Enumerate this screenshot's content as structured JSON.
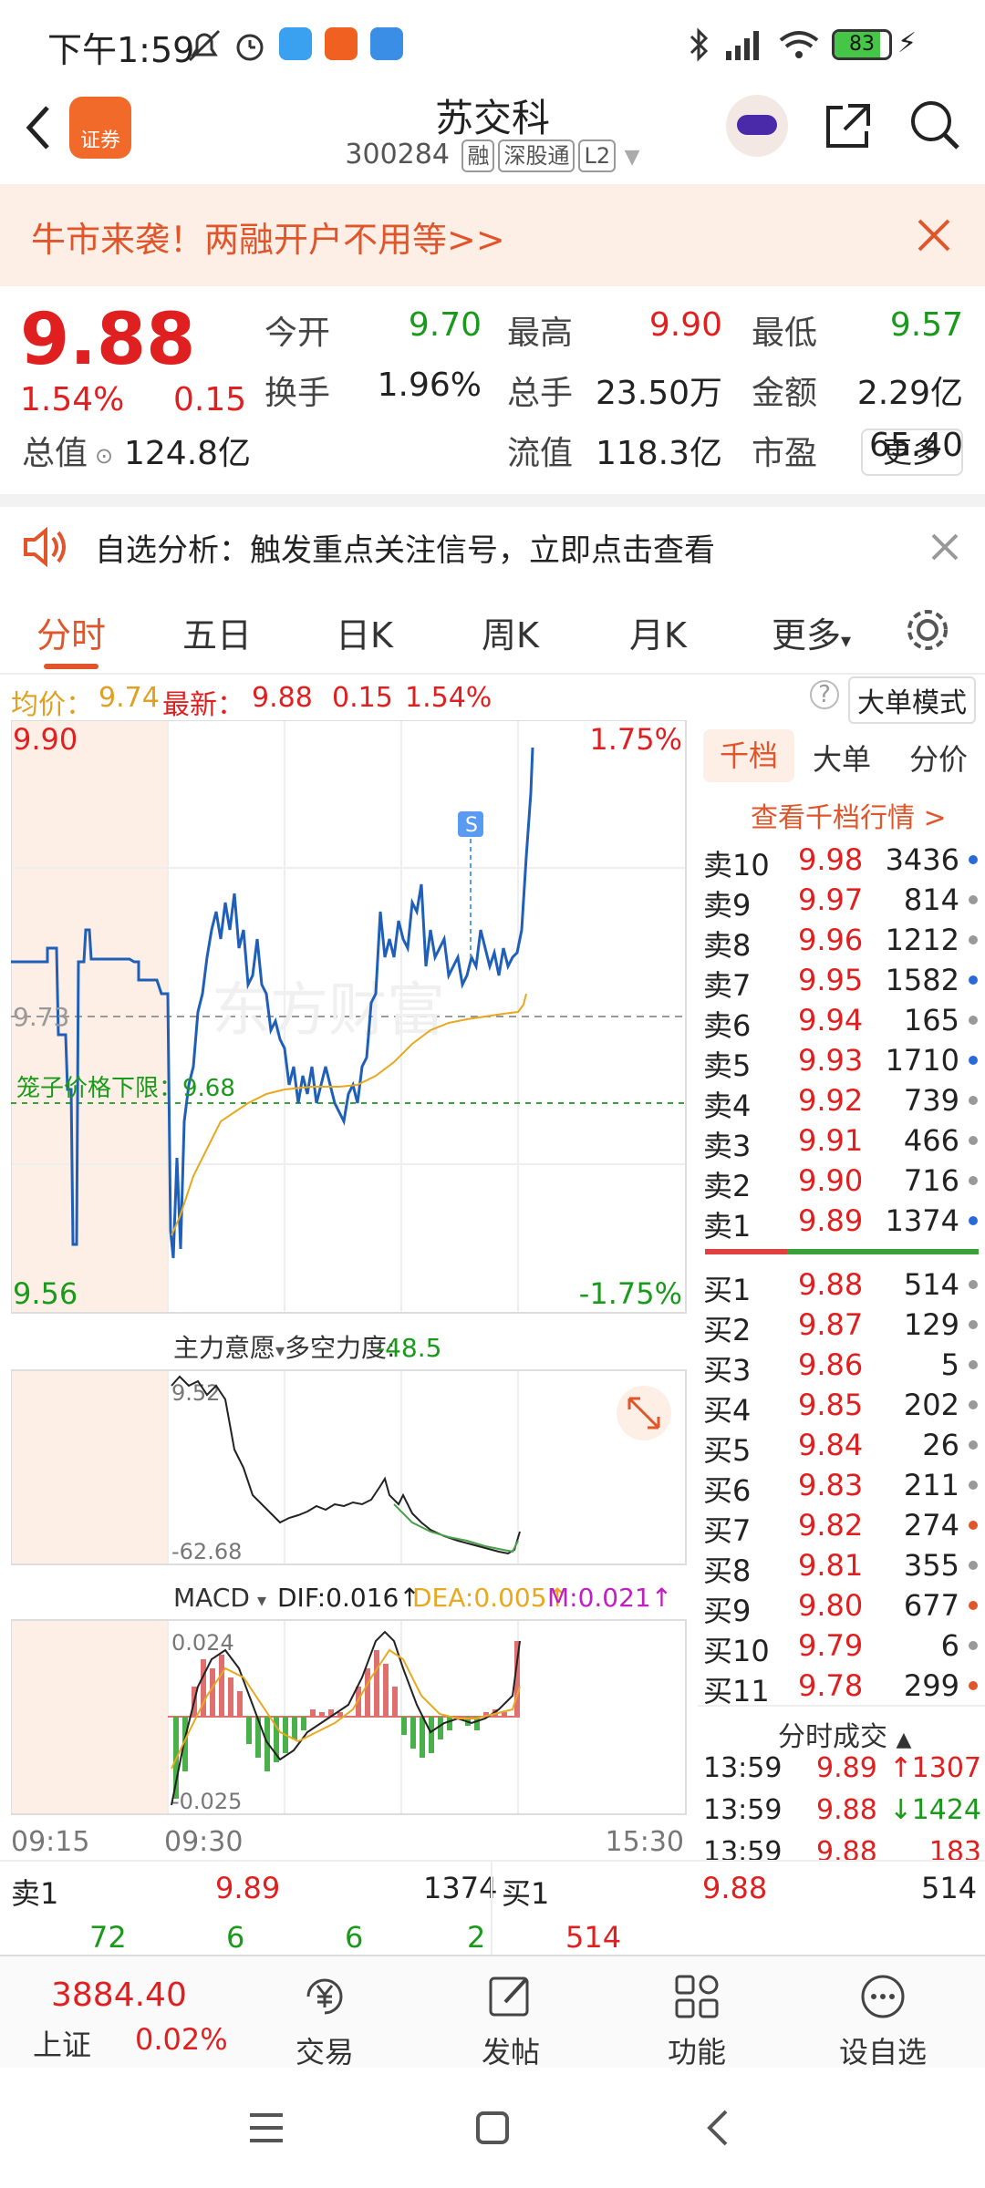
{
  "status_bar": {
    "time": "下午1:59",
    "battery": "83"
  },
  "header": {
    "app_badge": "证券",
    "title": "苏交科",
    "code": "300284",
    "tags": [
      "融",
      "深股通",
      "L2"
    ]
  },
  "banner": {
    "text": "牛市来袭！两融开户不用等>>"
  },
  "quote": {
    "price": "9.88",
    "change_pct": "1.54%",
    "change": "0.15",
    "fields": [
      {
        "label": "今开",
        "value": "9.70",
        "color": "#1a9a1a"
      },
      {
        "label": "最高",
        "value": "9.90",
        "color": "#e02020"
      },
      {
        "label": "最低",
        "value": "9.57",
        "color": "#1a9a1a"
      },
      {
        "label": "换手",
        "value": "1.96%",
        "color": "#222222"
      },
      {
        "label": "总手",
        "value": "23.50万",
        "color": "#222222"
      },
      {
        "label": "金额",
        "value": "2.29亿",
        "color": "#222222"
      },
      {
        "label": "总值",
        "value": "124.8亿",
        "color": "#222222"
      },
      {
        "label": "流值",
        "value": "118.3亿",
        "color": "#222222"
      },
      {
        "label": "市盈",
        "value": "65.40",
        "color": "#222222"
      }
    ],
    "more_label": "更多"
  },
  "alert": {
    "text": "自选分析：触发重点关注信号，立即点击查看"
  },
  "tabs": [
    "分时",
    "五日",
    "日K",
    "周K",
    "月K",
    "更多"
  ],
  "active_tab": "分时",
  "infobar": {
    "avg_label": "均价：",
    "avg_value": "9.74",
    "latest_label": "最新：",
    "latest_value": "9.88",
    "latest_change": "0.15",
    "latest_pct": "1.54%",
    "mode_button": "大单模式"
  },
  "chart": {
    "price_high": "9.90",
    "price_low": "9.56",
    "pct_high": "1.75%",
    "pct_low": "-1.75%",
    "mid_price": "9.73",
    "cage_label": "笼子价格下限：9.68",
    "indicator1_name": "主力意愿",
    "indicator1_label": "多空力度:",
    "indicator1_value": "-48.5",
    "indicator1_max": "9.52",
    "indicator1_min": "-62.68",
    "macd_name": "MACD",
    "macd_dif": "DIF:0.016↑",
    "macd_dea": "DEA:0.005↑",
    "macd_m": "M:0.021↑",
    "macd_max": "0.024",
    "macd_min": "-0.025",
    "time_start": "09:15",
    "time_open": "09:30",
    "time_end": "15:30",
    "signal_marker": "S",
    "watermark": "东方财富"
  },
  "right_panel": {
    "tabs": [
      "千档",
      "大单",
      "分价"
    ],
    "link": "查看千档行情 >",
    "asks": [
      {
        "label": "卖10",
        "price": "9.98",
        "vol": "3436",
        "dot": "#2a6ad8"
      },
      {
        "label": "卖9",
        "price": "9.97",
        "vol": "814",
        "dot": "#999999"
      },
      {
        "label": "卖8",
        "price": "9.96",
        "vol": "1212",
        "dot": "#999999"
      },
      {
        "label": "卖7",
        "price": "9.95",
        "vol": "1582",
        "dot": "#2a6ad8"
      },
      {
        "label": "卖6",
        "price": "9.94",
        "vol": "165",
        "dot": "#999999"
      },
      {
        "label": "卖5",
        "price": "9.93",
        "vol": "1710",
        "dot": "#2a6ad8"
      },
      {
        "label": "卖4",
        "price": "9.92",
        "vol": "739",
        "dot": "#999999"
      },
      {
        "label": "卖3",
        "price": "9.91",
        "vol": "466",
        "dot": "#999999"
      },
      {
        "label": "卖2",
        "price": "9.90",
        "vol": "716",
        "dot": "#999999"
      },
      {
        "label": "卖1",
        "price": "9.89",
        "vol": "1374",
        "dot": "#2a6ad8"
      }
    ],
    "bids": [
      {
        "label": "买1",
        "price": "9.88",
        "vol": "514",
        "dot": "#999999"
      },
      {
        "label": "买2",
        "price": "9.87",
        "vol": "129",
        "dot": "#999999"
      },
      {
        "label": "买3",
        "price": "9.86",
        "vol": "5",
        "dot": "#999999"
      },
      {
        "label": "买4",
        "price": "9.85",
        "vol": "202",
        "dot": "#999999"
      },
      {
        "label": "买5",
        "price": "9.84",
        "vol": "26",
        "dot": "#999999"
      },
      {
        "label": "买6",
        "price": "9.83",
        "vol": "211",
        "dot": "#999999"
      },
      {
        "label": "买7",
        "price": "9.82",
        "vol": "274",
        "dot": "#e0552a"
      },
      {
        "label": "买8",
        "price": "9.81",
        "vol": "355",
        "dot": "#999999"
      },
      {
        "label": "买9",
        "price": "9.80",
        "vol": "677",
        "dot": "#e0552a"
      },
      {
        "label": "买10",
        "price": "9.79",
        "vol": "6",
        "dot": "#999999"
      },
      {
        "label": "买11",
        "price": "9.78",
        "vol": "299",
        "dot": "#e0552a"
      }
    ],
    "trades_title": "分时成交",
    "trades": [
      {
        "time": "13:59",
        "price": "9.89",
        "arrow": "↑",
        "vol": "1307",
        "color": "#e02020"
      },
      {
        "time": "13:59",
        "price": "9.88",
        "arrow": "↓",
        "vol": "1424",
        "color": "#1a9a1a"
      },
      {
        "time": "13:59",
        "price": "9.88",
        "arrow": "",
        "vol": "183",
        "color": "#e02020"
      }
    ]
  },
  "bottom_ob": {
    "ask_label": "卖1",
    "ask_price": "9.89",
    "ask_vol": "1374",
    "bid_label": "买1",
    "bid_price": "9.88",
    "bid_vol": "514",
    "ask_queue": [
      "72",
      "6",
      "6",
      "2"
    ],
    "bid_queue": [
      "514"
    ]
  },
  "bottom_bar": {
    "index_value": "3884.40",
    "index_name": "上证",
    "index_pct": "0.02%",
    "items": [
      "交易",
      "发帖",
      "功能",
      "设自选"
    ]
  }
}
